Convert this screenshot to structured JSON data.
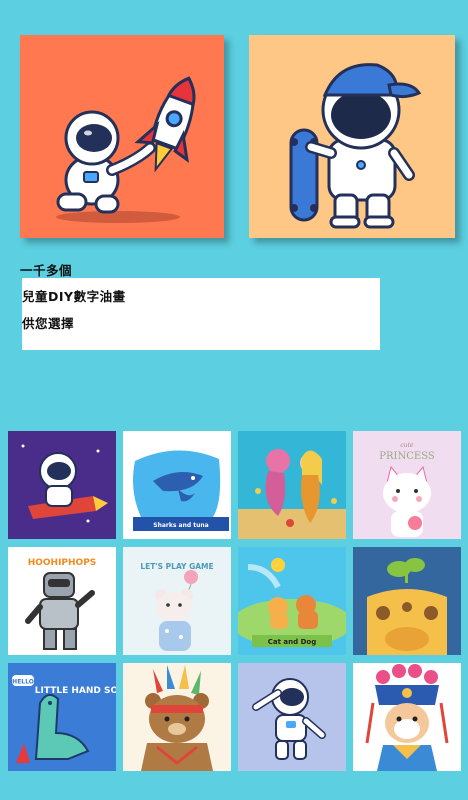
{
  "caption": {
    "line1": "一千多個",
    "line2": "兒童DIY數字油畫",
    "line3": "供您選擇"
  },
  "hero": [
    {
      "name": "astronaut-rocket-illustration",
      "bg": "#ff7850"
    },
    {
      "name": "astronaut-skateboard-illustration",
      "bg": "#ffc785"
    }
  ],
  "tiles": [
    {
      "name": "astronaut-rocket-tile",
      "bg": "#4a2d8a"
    },
    {
      "name": "shark-tile",
      "bg": "#ffffff",
      "text": "Sharks and tuna"
    },
    {
      "name": "mermaid-tile",
      "bg": "#34b6d6"
    },
    {
      "name": "princess-cat-tile",
      "bg": "#f1ddf0",
      "text": "PRINCESS",
      "small": "cute"
    },
    {
      "name": "robot-tile",
      "bg": "#ffffff",
      "text": "HOOHIPHOPS"
    },
    {
      "name": "bear-balloon-tile",
      "bg": "#eaf4f6",
      "text": "LET'S PLAY GAME"
    },
    {
      "name": "cat-dog-tile",
      "bg": "#4ec6ec",
      "text": "Cat and Dog"
    },
    {
      "name": "giraffe-tile",
      "bg": "#34679e"
    },
    {
      "name": "dinosaur-tile",
      "bg": "#3b7cd6",
      "text": "LITTLE HAND SOME",
      "small": "HELLO"
    },
    {
      "name": "native-bear-tile",
      "bg": "#fbf3e4"
    },
    {
      "name": "astronaut-dab-tile",
      "bg": "#b6c4ec"
    },
    {
      "name": "opera-dog-tile",
      "bg": "#ffffff"
    }
  ]
}
